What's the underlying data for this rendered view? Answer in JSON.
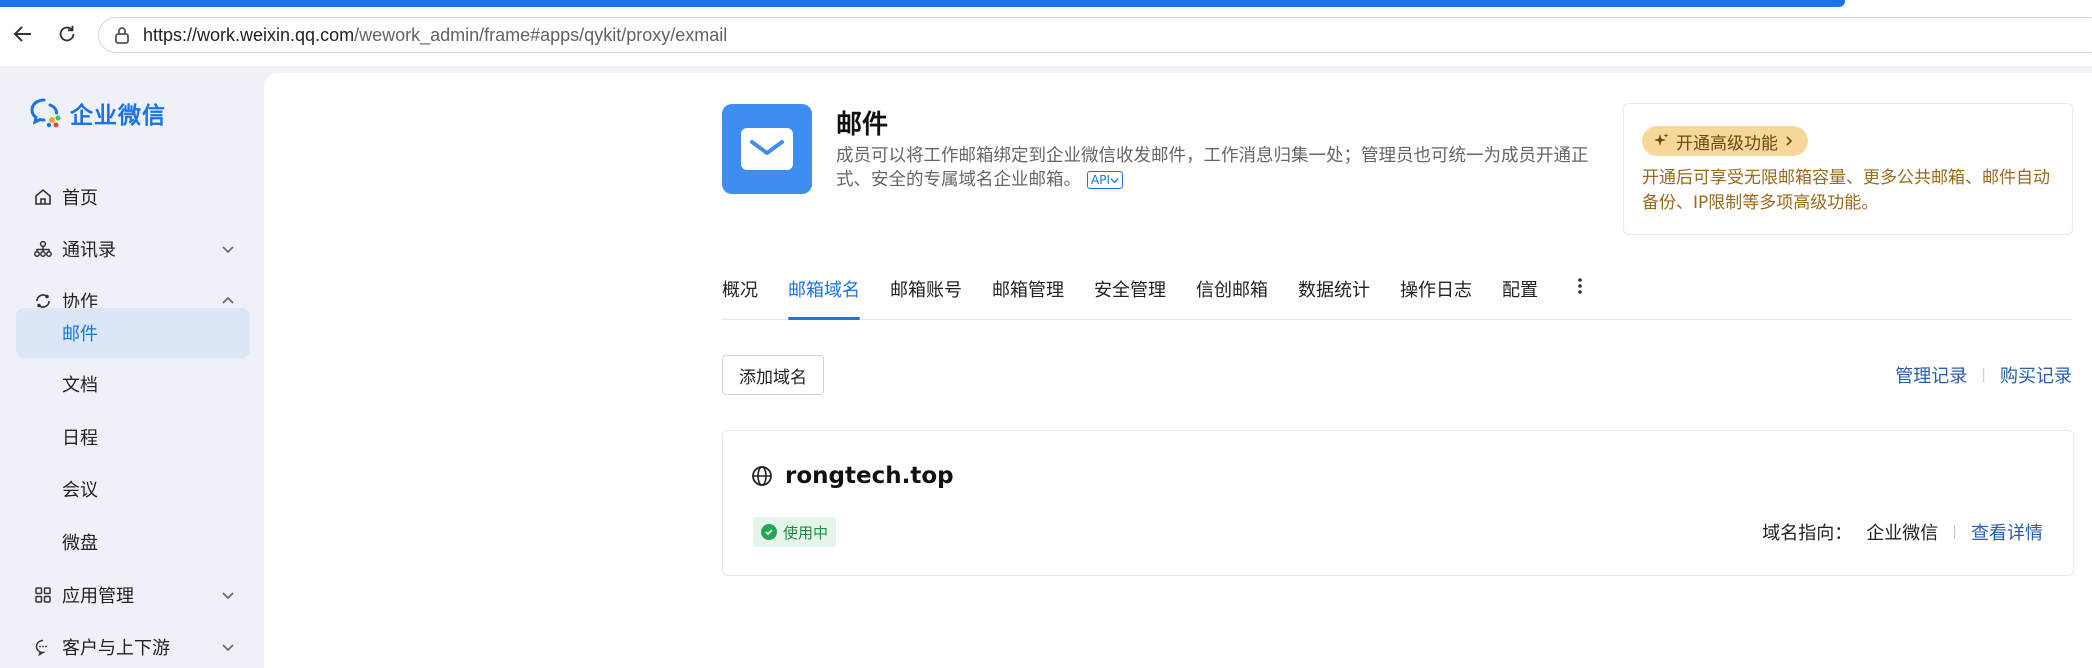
{
  "browser": {
    "url_host": "https://work.weixin.qq.com",
    "url_path": "/wework_admin/frame#apps/qykit/proxy/exmail"
  },
  "sidebar": {
    "logo_text": "企业微信",
    "items": [
      {
        "label": "首页",
        "icon": "home-icon"
      },
      {
        "label": "通讯录",
        "icon": "org-chart-icon",
        "arrow": "chevron-down"
      },
      {
        "label": "协作",
        "icon": "collaboration-icon",
        "arrow": "chevron-up"
      },
      {
        "label": "邮件",
        "active": true
      },
      {
        "label": "文档"
      },
      {
        "label": "日程"
      },
      {
        "label": "会议"
      },
      {
        "label": "微盘"
      },
      {
        "label": "应用管理",
        "icon": "apps-grid-icon",
        "arrow": "chevron-down"
      },
      {
        "label": "客户与上下游",
        "icon": "chat-icon",
        "arrow": "chevron-down"
      }
    ]
  },
  "app": {
    "title": "邮件",
    "description": "成员可以将工作邮箱绑定到企业微信收发邮件，工作消息归集一处；管理员也可统一为成员开通正式、安全的专属域名企业邮箱。",
    "api_badge": "API"
  },
  "promo": {
    "badge": "开通高级功能",
    "text": "开通后可享受无限邮箱容量、更多公共邮箱、邮件自动备份、IP限制等多项高级功能。"
  },
  "tabs": [
    "概况",
    "邮箱域名",
    "邮箱账号",
    "邮箱管理",
    "安全管理",
    "信创邮箱",
    "数据统计",
    "操作日志",
    "配置"
  ],
  "active_tab": "邮箱域名",
  "toolbar": {
    "add_domain": "添加域名",
    "manage_records": "管理记录",
    "purchase_records": "购买记录"
  },
  "domain": {
    "name": "rongtech.top",
    "status": "使用中",
    "pointing_label": "域名指向：",
    "pointing_value": "企业微信",
    "details_link": "查看详情"
  },
  "colors": {
    "accent": "#1a73e8",
    "sidebar_bg": "#eef2f8",
    "promo_badge": "#f7d79a",
    "status_green": "#23a755"
  }
}
